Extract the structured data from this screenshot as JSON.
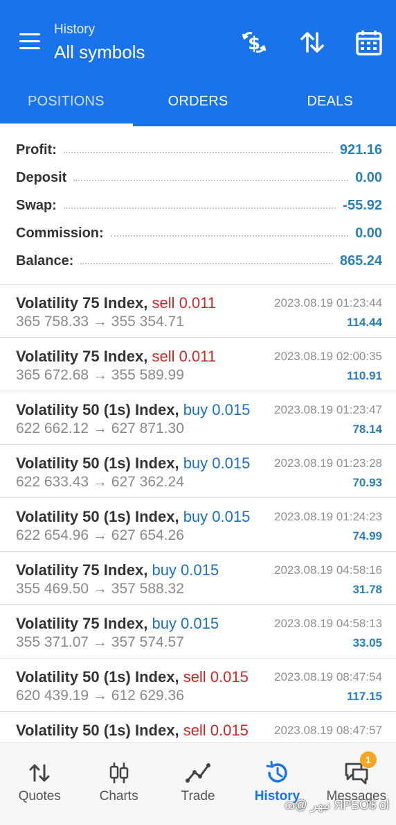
{
  "header": {
    "subtitle": "History",
    "title": "All symbols",
    "icons": [
      "currency-exchange-icon",
      "sort-icon",
      "calendar-icon"
    ]
  },
  "tabs": [
    {
      "label": "POSITIONS",
      "active": true
    },
    {
      "label": "ORDERS",
      "active": false
    },
    {
      "label": "DEALS",
      "active": false
    }
  ],
  "summary": [
    {
      "label": "Profit:",
      "value": "921.16"
    },
    {
      "label": "Deposit",
      "value": "0.00"
    },
    {
      "label": "Swap:",
      "value": "-55.92"
    },
    {
      "label": "Commission:",
      "value": "0.00"
    },
    {
      "label": "Balance:",
      "value": "865.24"
    }
  ],
  "deals": [
    {
      "symbol": "Volatility 75 Index,",
      "side": "sell 0.011",
      "side_type": "sell",
      "prices": "365 758.33 → 355 354.71",
      "time": "2023.08.19 01:23:44",
      "profit": "114.44"
    },
    {
      "symbol": "Volatility 75 Index,",
      "side": "sell 0.011",
      "side_type": "sell",
      "prices": "365 672.68 → 355 589.99",
      "time": "2023.08.19 02:00:35",
      "profit": "110.91"
    },
    {
      "symbol": "Volatility 50 (1s) Index,",
      "side": "buy 0.015",
      "side_type": "buy",
      "prices": "622 662.12 → 627 871.30",
      "time": "2023.08.19 01:23:47",
      "profit": "78.14"
    },
    {
      "symbol": "Volatility 50 (1s) Index,",
      "side": "buy 0.015",
      "side_type": "buy",
      "prices": "622 633.43 → 627 362.24",
      "time": "2023.08.19 01:23:28",
      "profit": "70.93"
    },
    {
      "symbol": "Volatility 50 (1s) Index,",
      "side": "buy 0.015",
      "side_type": "buy",
      "prices": "622 654.96 → 627 654.26",
      "time": "2023.08.19 01:24:23",
      "profit": "74.99"
    },
    {
      "symbol": "Volatility 75 Index,",
      "side": "buy 0.015",
      "side_type": "buy",
      "prices": "355 469.50 → 357 588.32",
      "time": "2023.08.19 04:58:16",
      "profit": "31.78"
    },
    {
      "symbol": "Volatility 75 Index,",
      "side": "buy 0.015",
      "side_type": "buy",
      "prices": "355 371.07 → 357 574.57",
      "time": "2023.08.19 04:58:13",
      "profit": "33.05"
    },
    {
      "symbol": "Volatility 50 (1s) Index,",
      "side": "sell 0.015",
      "side_type": "sell",
      "prices": "620 439.19 → 612 629.36",
      "time": "2023.08.19 08:47:54",
      "profit": "117.15"
    },
    {
      "symbol": "Volatility 50 (1s) Index,",
      "side": "sell 0.015",
      "side_type": "sell",
      "prices": "",
      "time": "2023.08.19 08:47:57",
      "profit": ""
    }
  ],
  "bottom_nav": [
    {
      "label": "Quotes",
      "icon": "quotes-icon",
      "active": false
    },
    {
      "label": "Charts",
      "icon": "charts-icon",
      "active": false
    },
    {
      "label": "Trade",
      "icon": "trade-icon",
      "active": false
    },
    {
      "label": "History",
      "icon": "history-icon",
      "active": true
    },
    {
      "label": "Messages",
      "icon": "messages-icon",
      "active": false,
      "badge": "1"
    }
  ],
  "watermark": "ɷ@ نيهر ЯРБО$ ol"
}
